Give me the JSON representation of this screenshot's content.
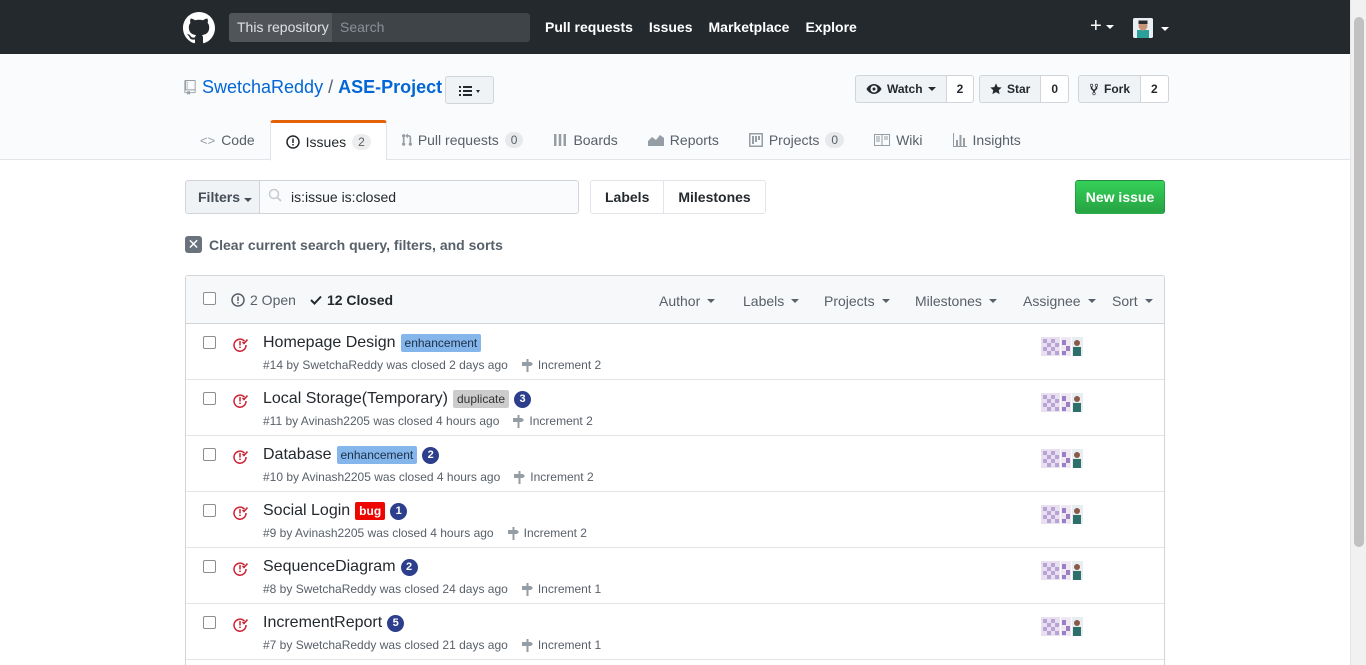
{
  "header": {
    "search_scope": "This repository",
    "search_placeholder": "Search",
    "nav": [
      "Pull requests",
      "Issues",
      "Marketplace",
      "Explore"
    ],
    "plus": "+"
  },
  "repo": {
    "owner": "SwetchaReddy",
    "separator": "/",
    "name": "ASE-Project",
    "watch_label": "Watch",
    "watch_count": "2",
    "star_label": "Star",
    "star_count": "0",
    "fork_label": "Fork",
    "fork_count": "2"
  },
  "tabs": [
    {
      "label": "Code",
      "count": null
    },
    {
      "label": "Issues",
      "count": "2"
    },
    {
      "label": "Pull requests",
      "count": "0"
    },
    {
      "label": "Boards",
      "count": null
    },
    {
      "label": "Reports",
      "count": null
    },
    {
      "label": "Projects",
      "count": "0"
    },
    {
      "label": "Wiki",
      "count": null
    },
    {
      "label": "Insights",
      "count": null
    }
  ],
  "filters": {
    "filters_label": "Filters",
    "query": "is:issue is:closed",
    "labels_label": "Labels",
    "milestones_label": "Milestones",
    "new_issue_label": "New issue",
    "clear_label": "Clear current search query, filters, and sorts"
  },
  "list_header": {
    "open_label": "2 Open",
    "closed_label": "12 Closed",
    "menus": [
      "Author",
      "Labels",
      "Projects",
      "Milestones",
      "Assignee",
      "Sort"
    ]
  },
  "issues": [
    {
      "title": "Homepage Design",
      "label": "enhancement",
      "comments": null,
      "meta": "#14 by SwetchaReddy was closed 2 days ago",
      "milestone": "Increment 2"
    },
    {
      "title": "Local Storage(Temporary)",
      "label": "duplicate",
      "comments": "3",
      "meta": "#11 by Avinash2205 was closed 4 hours ago",
      "milestone": "Increment 2"
    },
    {
      "title": "Database",
      "label": "enhancement",
      "comments": "2",
      "meta": "#10 by Avinash2205 was closed 4 hours ago",
      "milestone": "Increment 2"
    },
    {
      "title": "Social Login",
      "label": "bug",
      "comments": "1",
      "meta": "#9 by Avinash2205 was closed 4 hours ago",
      "milestone": "Increment 2"
    },
    {
      "title": "SequenceDiagram",
      "label": null,
      "comments": "2",
      "meta": "#8 by SwetchaReddy was closed 24 days ago",
      "milestone": "Increment 1"
    },
    {
      "title": "IncrementReport",
      "label": null,
      "comments": "5",
      "meta": "#7 by SwetchaReddy was closed 21 days ago",
      "milestone": "Increment 1"
    }
  ],
  "colors": {
    "header_bg": "#24292e",
    "link": "#0366d6",
    "green": "#28a745",
    "closed_icon": "#cb2431",
    "label_enhancement": "#84b6eb",
    "label_duplicate": "#cccccc",
    "label_bug": "#ee0701",
    "tab_accent": "#e36209"
  }
}
